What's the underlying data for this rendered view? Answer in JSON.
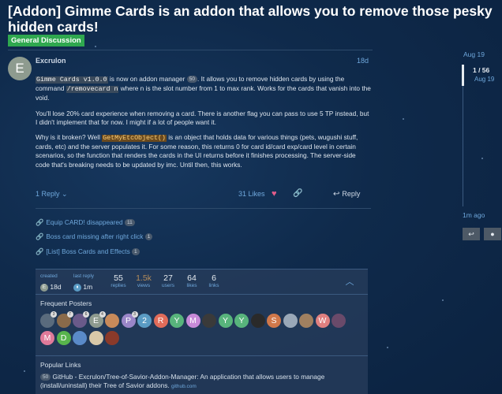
{
  "topic": {
    "title": "[Addon] Gimme Cards is an addon that allows you to remove those pesky hidden cards!",
    "category": "General Discussion",
    "category_color": "#2fa84f"
  },
  "post": {
    "avatar_letter": "E",
    "username": "Excrulon",
    "date": "18d",
    "p1_code": "Gimme Cards v1.0.0",
    "p1_a": " is now on addon manager ",
    "p1_badge": "50",
    "p1_b": ". It allows you to remove hidden cards by using the command ",
    "p1_cmd": "/removecard n",
    "p1_c": " where n is the slot number from 1 to max rank. Works for the cards that vanish into the void.",
    "p2": "You'll lose 20% card experience when removing a card. There is another flag you can pass to use 5 TP instead, but I didn't implement that for now. I might if a lot of people want it.",
    "p3_a": "Why is it broken? Well ",
    "p3_code": "GetMyEtcObject()",
    "p3_b": " is an object that holds data for various things (pets, wugushi stuff, cards, etc) and the server populates it. For some reason, this returns 0 for card id/card exp/card level in certain scenarios, so the function that renders the cards in the UI returns before it finishes processing. The server-side code that's breaking needs to be updated by imc. Until then, this works.",
    "reply_count": "1 Reply",
    "likes": "31 Likes",
    "reply_label": "Reply"
  },
  "related_links": [
    {
      "label": "Equip CARD! disappeared",
      "count": "11"
    },
    {
      "label": "Boss card missing after right click",
      "count": "1"
    },
    {
      "label": "[List] Boss Cards and Effects",
      "count": "1"
    }
  ],
  "summary": {
    "created_label": "created",
    "created_value": "18d",
    "last_reply_label": "last reply",
    "last_reply_value": "1m",
    "stats": [
      {
        "num": "55",
        "label": "replies"
      },
      {
        "num": "1.5k",
        "label": "views"
      },
      {
        "num": "27",
        "label": "users"
      },
      {
        "num": "64",
        "label": "likes"
      },
      {
        "num": "6",
        "label": "links"
      }
    ],
    "frequent_posters_title": "Frequent Posters",
    "frequent_posters": [
      {
        "letter": "",
        "color": "#5a6b7d",
        "badge": "3"
      },
      {
        "letter": "",
        "color": "#8a6a4a",
        "badge": "7"
      },
      {
        "letter": "",
        "color": "#6a5a8a",
        "badge": "6"
      },
      {
        "letter": "E",
        "color": "#8e9b8f",
        "badge": "4"
      },
      {
        "letter": "",
        "color": "#c88a5a",
        "badge": ""
      },
      {
        "letter": "P",
        "color": "#9a86c8",
        "badge": "3"
      },
      {
        "letter": "2",
        "color": "#5a9bc4",
        "badge": ""
      },
      {
        "letter": "R",
        "color": "#e06c5a",
        "badge": ""
      },
      {
        "letter": "Y",
        "color": "#58b47c",
        "badge": ""
      },
      {
        "letter": "M",
        "color": "#c88ad8",
        "badge": ""
      },
      {
        "letter": "",
        "color": "#3a3a3a",
        "badge": ""
      },
      {
        "letter": "Y",
        "color": "#58b47c",
        "badge": ""
      },
      {
        "letter": "Y",
        "color": "#58b47c",
        "badge": ""
      },
      {
        "letter": "",
        "color": "#2a2a2a",
        "badge": ""
      },
      {
        "letter": "S",
        "color": "#d0784a",
        "badge": ""
      },
      {
        "letter": "",
        "color": "#9aa8b8",
        "badge": ""
      },
      {
        "letter": "",
        "color": "#a08060",
        "badge": ""
      },
      {
        "letter": "W",
        "color": "#e08080",
        "badge": ""
      },
      {
        "letter": "",
        "color": "#6a4a6a",
        "badge": ""
      },
      {
        "letter": "M",
        "color": "#e07a9a",
        "badge": ""
      },
      {
        "letter": "D",
        "color": "#58b44c",
        "badge": ""
      },
      {
        "letter": "",
        "color": "#5a8ac8",
        "badge": ""
      },
      {
        "letter": "",
        "color": "#d8c8a8",
        "badge": ""
      },
      {
        "letter": "",
        "color": "#8a3a2a",
        "badge": ""
      }
    ],
    "popular_links_title": "Popular Links",
    "popular_link_count": "50",
    "popular_link_text": "GitHub - Excrulon/Tree-of-Savior-Addon-Manager: An application that allows users to manage (install/uninstall) their Tree of Savior addons.",
    "popular_link_domain": "github.com"
  },
  "timeline": {
    "start_date": "Aug 19",
    "position": "1 / 56",
    "position_date": "Aug 19",
    "end_label": "1m ago"
  }
}
